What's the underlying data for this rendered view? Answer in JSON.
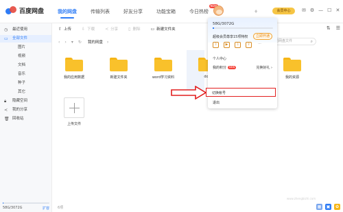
{
  "app": {
    "name": "百度网盘",
    "logo_icon": "baidu-cloud-logo-icon"
  },
  "topnav": [
    {
      "label": "我的网盘",
      "active": true
    },
    {
      "label": "传输列表",
      "active": false
    },
    {
      "label": "好友分享",
      "active": false
    },
    {
      "label": "功能宝箱",
      "active": false
    },
    {
      "label": "今日热榜",
      "active": false,
      "badge": "NEW"
    }
  ],
  "header": {
    "vip_button": "会员中心",
    "icons": [
      "diamond-icon",
      "mail-icon",
      "gear-icon",
      "minimize-icon",
      "maximize-icon",
      "close-icon"
    ]
  },
  "sidebar": {
    "items": [
      {
        "label": "最近使用",
        "icon": "clock-icon"
      },
      {
        "label": "全部文件",
        "icon": "folder-icon",
        "active": true
      },
      {
        "label": "图片",
        "sub": true
      },
      {
        "label": "视频",
        "sub": true
      },
      {
        "label": "文档",
        "sub": true
      },
      {
        "label": "音乐",
        "sub": true
      },
      {
        "label": "种子",
        "sub": true
      },
      {
        "label": "其它",
        "sub": true
      },
      {
        "label": "隐藏空间",
        "icon": "lock-icon"
      },
      {
        "label": "我的分享",
        "icon": "share-icon"
      },
      {
        "label": "回收站",
        "icon": "trash-icon"
      }
    ],
    "storage": {
      "text": "58G/3072G",
      "expand": "扩容",
      "used_fraction": 0.019
    }
  },
  "toolbar": {
    "buttons": [
      {
        "label": "上传",
        "icon": "upload-icon",
        "enabled": true
      },
      {
        "label": "下载",
        "icon": "download-icon",
        "enabled": false
      },
      {
        "label": "分享",
        "icon": "share-icon",
        "enabled": false
      },
      {
        "label": "删除",
        "icon": "trash-icon",
        "enabled": false
      },
      {
        "label": "新建文件夹",
        "icon": "new-folder-icon",
        "enabled": true
      }
    ]
  },
  "pathbar": {
    "crumb": "我的网盘",
    "search_placeholder": "搜索我的网盘文件"
  },
  "files": [
    {
      "name": "我的应用数据",
      "type": "folder"
    },
    {
      "name": "新建文件夹",
      "type": "folder"
    },
    {
      "name": "word学习资料",
      "type": "folder"
    },
    {
      "name": "dov",
      "type": "folder"
    },
    {
      "name": "我的资源",
      "type": "folder"
    },
    {
      "name": "上传文件",
      "type": "upload"
    }
  ],
  "popup": {
    "storage_text": "58G/3072G",
    "used_fraction": 0.019,
    "vip_text": "超级会员尊享15项特权",
    "vip_open": "立即开通",
    "icon_names": [
      "speed-icon",
      "video-icon",
      "download-icon",
      "upload-icon",
      "more-icon"
    ],
    "icon_glyphs": [
      "⇧",
      "▶",
      "⇩",
      "⇪",
      "···"
    ],
    "personal_center": "个人中心",
    "my_points": "我的积分",
    "points_badge": "NEW",
    "gift": "兑换好礼 ›",
    "switch_account": "切换帐号",
    "logout": "退出"
  },
  "statusbar": {
    "count": "6项",
    "watermark": "www.zhengbizhi.com"
  }
}
